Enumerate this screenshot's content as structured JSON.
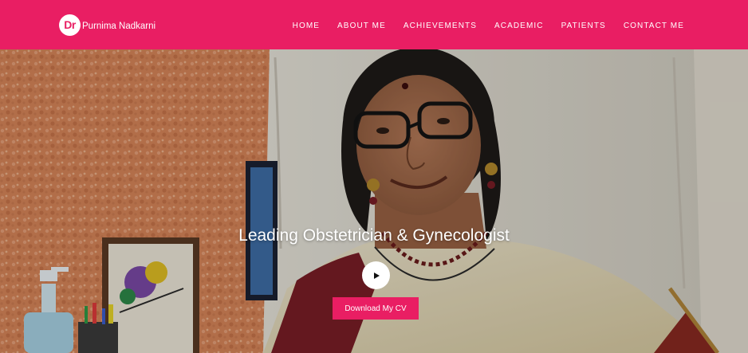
{
  "brand": {
    "badge_text": "Dr",
    "name": "Purnima Nadkarni"
  },
  "nav": {
    "items": [
      {
        "label": "HOME"
      },
      {
        "label": "ABOUT ME"
      },
      {
        "label": "ACHIEVEMENTS"
      },
      {
        "label": "ACADEMIC"
      },
      {
        "label": "PATIENTS"
      },
      {
        "label": "CONTACT ME"
      }
    ]
  },
  "hero": {
    "title": "Leading Obstetrician & Gynecologist",
    "play_icon": "play-icon",
    "cv_button_label": "Download My CV"
  },
  "colors": {
    "brand_pink": "#e91e63",
    "white": "#ffffff"
  }
}
